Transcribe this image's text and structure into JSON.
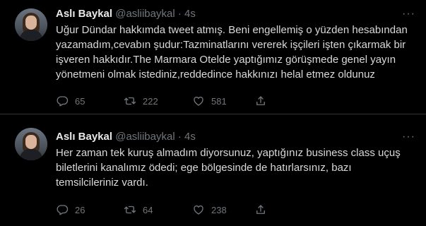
{
  "tweets": [
    {
      "name": "Aslı Baykal",
      "handle": "@asliibaykal",
      "dot": "·",
      "time": "4s",
      "more": "···",
      "text": "Uğur Dündar hakkımda tweet atmış. Beni engellemiş o yüzden hesabından yazamadım,cevabın şudur:Tazminatlarını vererek işçileri işten çıkarmak bir işveren hakkıdır.The Marmara Otelde yaptığımız görüşmede genel yayın yönetmeni olmak istediniz,reddedince hakkınızı helal etmez oldunuz",
      "replies": "65",
      "retweets": "222",
      "likes": "581"
    },
    {
      "name": "Aslı Baykal",
      "handle": "@asliibaykal",
      "dot": "·",
      "time": "4s",
      "more": "···",
      "text": "Her zaman tek kuruş almadım diyorsunuz, yaptığınız business class uçuş biletlerini kanalımız ödedi;  ege bölgesinde de hatırlarsınız, bazı temsilcileriniz vardı.",
      "replies": "26",
      "retweets": "64",
      "likes": "238"
    }
  ],
  "icons": {
    "reply": "reply-icon",
    "retweet": "retweet-icon",
    "like": "heart-icon",
    "share": "share-icon",
    "more": "more-icon"
  },
  "colors": {
    "background": "#000000",
    "text": "#d9d9d9",
    "muted": "#71767b",
    "divider": "#2f3336"
  }
}
